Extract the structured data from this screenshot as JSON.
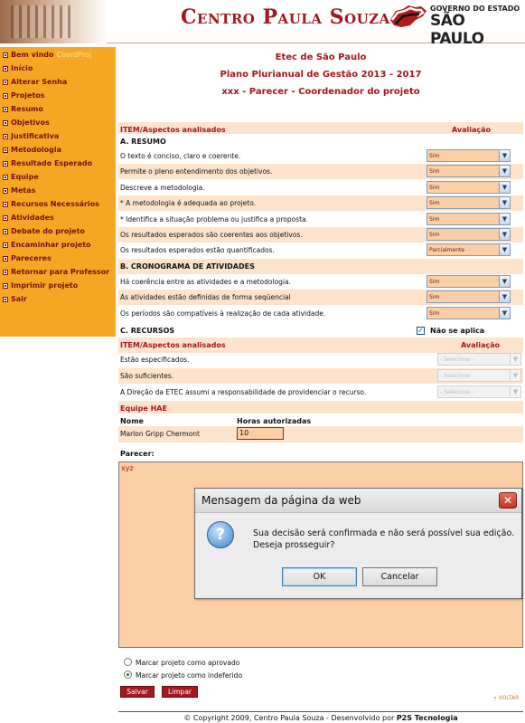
{
  "header": {
    "brand": "Centro Paula Souza",
    "gov_line1": "GOVERNO DO ESTADO",
    "gov_line2": "SÃO PAULO"
  },
  "sidebar": {
    "welcome": "Bem vindo",
    "user": "CoordProj",
    "items": [
      "Início",
      "Alterar Senha",
      "Projetos",
      "Resumo",
      "Objetivos",
      "Justificativa",
      "Metodologia",
      "Resultado Esperado",
      "Equipe",
      "Metas",
      "Recursos Necessários",
      "Atividades",
      "Debate do projeto",
      "Encaminhar projeto",
      "Pareceres",
      "Retornar para Professor",
      "Imprimir projeto",
      "Sair"
    ]
  },
  "titles": {
    "school": "Etec de São Paulo",
    "plan": "Plano Plurianual de Gestão 2013 - 2017",
    "role": "xxx - Parecer - Coordenador do projeto"
  },
  "table": {
    "col_item": "ITEM/Aspectos analisados",
    "col_eval": "Avaliação",
    "section_a": "A. RESUMO",
    "a_rows": [
      {
        "text": "O texto é conciso, claro e coerente.",
        "value": "Sim"
      },
      {
        "text": "Permite o pleno entendimento dos objetivos.",
        "value": "Sim"
      },
      {
        "text": "Descreve a metodologia.",
        "value": "Sim"
      },
      {
        "text": "* A metodologia é adequada ao projeto.",
        "value": "Sim"
      },
      {
        "text": "* Identifica a situação problema ou justifica a proposta.",
        "value": "Sim"
      },
      {
        "text": "Os resultados esperados são coerentes aos objetivos.",
        "value": "Sim"
      },
      {
        "text": "Os resultados esperados estão quantificados.",
        "value": "Parcialmente"
      }
    ],
    "section_b": "B. CRONOGRAMA DE ATIVIDADES",
    "b_rows": [
      {
        "text": "Há coerência entre as atividades e a metodologia.",
        "value": "Sim"
      },
      {
        "text": "As atividades estão definidas de forma seqüencial",
        "value": "Sim"
      },
      {
        "text": "Os períodos são compatíveis à realização de cada atividade.",
        "value": "Sim"
      }
    ],
    "section_c": "C. RECURSOS",
    "nao_se_aplica": "Não se aplica",
    "c_rows": [
      {
        "text": "Estão especificados.",
        "value": "- Selecione -"
      },
      {
        "text": "São suficientes.",
        "value": "- Selecione -"
      },
      {
        "text": "A Direção da ETEC assumi a responsabilidade de providenciar o recurso.",
        "value": "- Selecione -"
      }
    ]
  },
  "hae": {
    "title": "Equipe HAE",
    "col_name": "Nome",
    "col_hours": "Horas autorizadas",
    "name": "Marlon Gripp Chermont",
    "hours": "10"
  },
  "parecer": {
    "label": "Parecer:",
    "text": "xyz"
  },
  "options": {
    "approve": "Marcar projeto como aprovado",
    "reject": "Marcar projeto como indeferido"
  },
  "buttons": {
    "save": "Salvar",
    "clear": "Limpar",
    "back": "« VOLTAR"
  },
  "footer": {
    "text": "© Copyright 2009, Centro Paula Souza - Desenvolvido por",
    "company": "P2S Tecnologia"
  },
  "dialog": {
    "title": "Mensagem da página da web",
    "message": "Sua decisão será confirmada e não será possível sua edição. Deseja prosseguir?",
    "ok": "OK",
    "cancel": "Cancelar"
  }
}
